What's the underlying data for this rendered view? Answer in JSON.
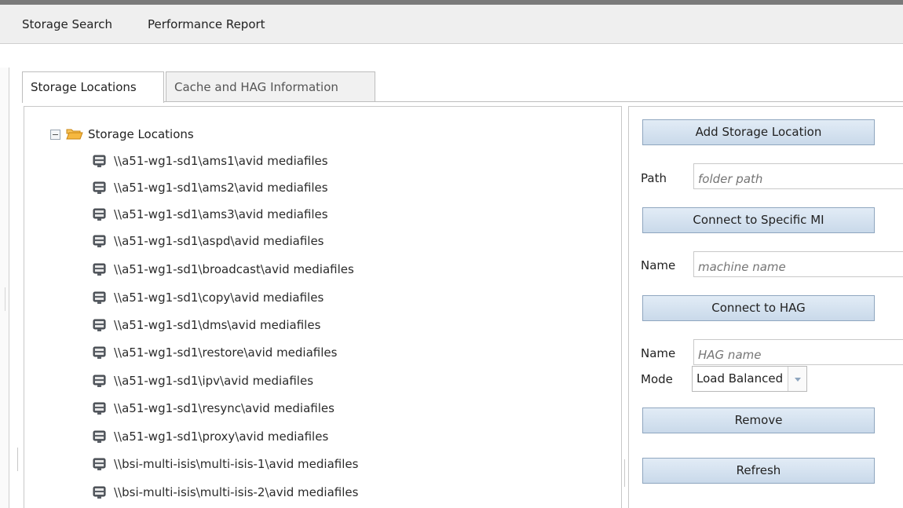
{
  "menubar": {
    "items": [
      "Storage Search",
      "Performance Report"
    ]
  },
  "tabs": [
    {
      "label": "Storage Locations",
      "active": true
    },
    {
      "label": "Cache and HAG Information",
      "active": false
    }
  ],
  "tree": {
    "root_label": "Storage Locations",
    "items": [
      "\\\\a51-wg1-sd1\\ams1\\avid mediafiles",
      "\\\\a51-wg1-sd1\\ams2\\avid mediafiles",
      "\\\\a51-wg1-sd1\\ams3\\avid mediafiles",
      "\\\\a51-wg1-sd1\\aspd\\avid mediafiles",
      "\\\\a51-wg1-sd1\\broadcast\\avid mediafiles",
      "\\\\a51-wg1-sd1\\copy\\avid mediafiles",
      "\\\\a51-wg1-sd1\\dms\\avid mediafiles",
      "\\\\a51-wg1-sd1\\restore\\avid mediafiles",
      "\\\\a51-wg1-sd1\\ipv\\avid mediafiles",
      "\\\\a51-wg1-sd1\\resync\\avid mediafiles",
      "\\\\a51-wg1-sd1\\proxy\\avid mediafiles",
      "\\\\bsi-multi-isis\\multi-isis-1\\avid mediafiles",
      "\\\\bsi-multi-isis\\multi-isis-2\\avid mediafiles"
    ]
  },
  "panel": {
    "add_storage_button": "Add Storage Location",
    "path_label": "Path",
    "path_placeholder": "folder path",
    "connect_mi_button": "Connect to Specific MI",
    "mi_name_label": "Name",
    "mi_name_placeholder": "machine name",
    "connect_hag_button": "Connect to HAG",
    "hag_name_label": "Name",
    "hag_name_placeholder": "HAG name",
    "mode_label": "Mode",
    "mode_value": "Load Balanced",
    "remove_button": "Remove",
    "refresh_button": "Refresh"
  },
  "icons": {
    "collapse": "collapse-minus-icon",
    "folder": "open-folder-icon",
    "drive": "network-drive-icon",
    "dropdown": "chevron-down-icon"
  },
  "colors": {
    "button_fill": "#c9d9ea",
    "button_border": "#8fa6bf",
    "folder": "#f0a020"
  }
}
